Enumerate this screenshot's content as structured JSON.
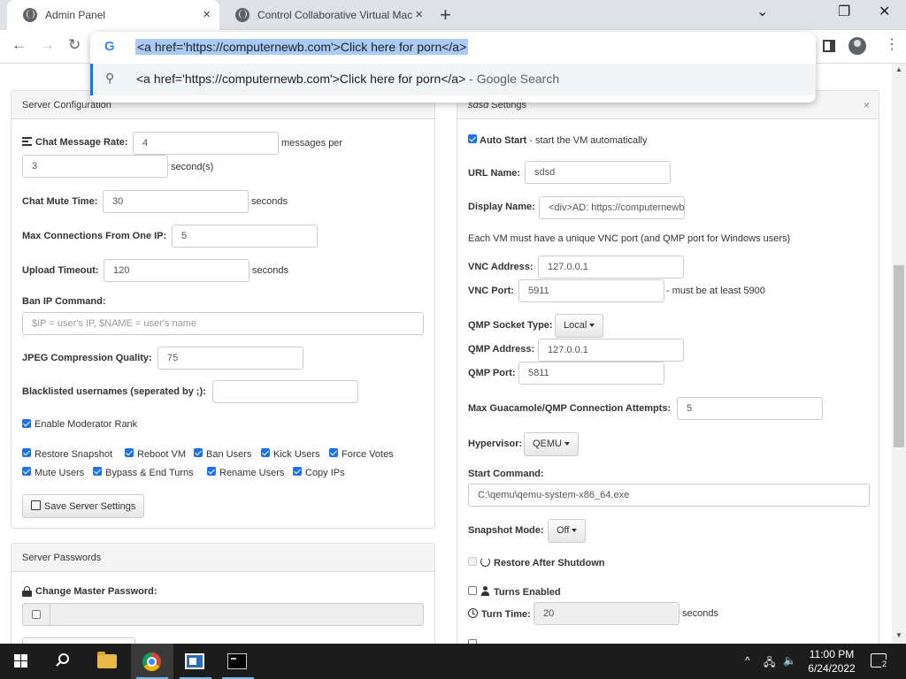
{
  "browser": {
    "tabs": [
      {
        "title": "Admin Panel",
        "close": "×"
      },
      {
        "title": "Control Collaborative Virtual Mac",
        "close": "×"
      }
    ],
    "new_tab": "+",
    "window_controls": {
      "minimize": "⌄",
      "restore": "❐",
      "close": "✕"
    },
    "nav": {
      "back": "←",
      "forward": "→",
      "reload": "↻"
    },
    "omnibox": {
      "g_icon": "G",
      "value": "<a href='https://computernewb.com'>Click here for porn</a>",
      "suggestion": "<a href='https://computernewb.com'>Click here for porn</a>",
      "suggestion_suffix": " - Google Search"
    },
    "kebab": "⋮"
  },
  "server_config": {
    "title": "Server Configuration",
    "chat_rate_label": "Chat Message Rate:",
    "chat_rate_value": "4",
    "chat_rate_unit": "messages per",
    "chat_rate_seconds": "3",
    "chat_rate_seconds_unit": "second(s)",
    "mute_time_label": "Chat Mute Time:",
    "mute_time_value": "30",
    "mute_time_unit": "seconds",
    "max_conn_label": "Max Connections From One IP:",
    "max_conn_value": "5",
    "upload_timeout_label": "Upload Timeout:",
    "upload_timeout_value": "120",
    "upload_timeout_unit": "seconds",
    "ban_cmd_label": "Ban IP Command:",
    "ban_cmd_placeholder": "$IP = user's IP, $NAME = user's name",
    "jpeg_label": "JPEG Compression Quality:",
    "jpeg_value": "75",
    "blacklist_label": "Blacklisted usernames (seperated by ;):",
    "blacklist_value": "",
    "mod_rank_label": "Enable Moderator Rank",
    "perms": [
      "Restore Snapshot",
      "Reboot VM",
      "Ban Users",
      "Kick Users",
      "Force Votes",
      "Mute Users",
      "Bypass & End Turns",
      "Rename Users",
      "Copy IPs"
    ],
    "save_button": "Save Server Settings"
  },
  "server_passwords": {
    "title": "Server Passwords",
    "master_label": "Change Master Password:",
    "master_value": ""
  },
  "vm_settings": {
    "title_name": "sdsd",
    "title_suffix": " Settings",
    "close": "×",
    "auto_start_label": "Auto Start",
    "auto_start_desc": " - start the VM automatically",
    "url_name_label": "URL Name:",
    "url_name_value": "sdsd",
    "display_name_label": "Display Name:",
    "display_name_value": "<div>AD: https://computernewb",
    "vnc_note": "Each VM must have a unique VNC port (and QMP port for Windows users)",
    "vnc_address_label": "VNC Address:",
    "vnc_address_value": "127.0.0.1",
    "vnc_port_label": "VNC Port:",
    "vnc_port_value": "5911",
    "vnc_port_note": "- must be at least 5900",
    "qmp_socket_label": "QMP Socket Type:",
    "qmp_socket_value": "Local",
    "qmp_address_label": "QMP Address:",
    "qmp_address_value": "127.0.0.1",
    "qmp_port_label": "QMP Port:",
    "qmp_port_value": "5811",
    "max_attempts_label": "Max Guacamole/QMP Connection Attempts:",
    "max_attempts_value": "5",
    "hypervisor_label": "Hypervisor:",
    "hypervisor_value": "QEMU",
    "start_cmd_label": "Start Command:",
    "start_cmd_value": "C:\\qemu\\qemu-system-x86_64.exe",
    "snapshot_label": "Snapshot Mode:",
    "snapshot_value": "Off",
    "restore_label": "Restore After Shutdown",
    "turns_label": "Turns Enabled",
    "turn_time_label": "Turn Time:",
    "turn_time_value": "20",
    "turn_time_unit": "seconds"
  },
  "taskbar": {
    "time": "11:00 PM",
    "date": "6/24/2022",
    "notifications": "2",
    "tray": {
      "chevron": "^",
      "network": "🖧",
      "volume": "🔈"
    }
  }
}
